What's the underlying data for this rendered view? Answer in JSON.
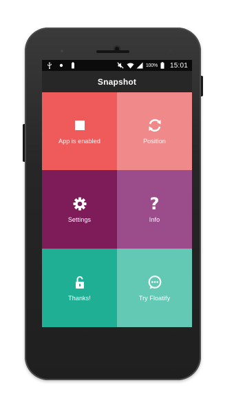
{
  "status_bar": {
    "battery_percent": "100%",
    "time": "15:01",
    "left_icons": [
      "usb-icon",
      "dot-icon",
      "battery-saver-icon"
    ],
    "right_icons": [
      "mute-icon",
      "wifi-icon",
      "signal-icon",
      "battery-icon"
    ]
  },
  "app_bar": {
    "title": "Snapshot"
  },
  "tiles": [
    {
      "label": "App is enabled",
      "icon": "stop-square-icon",
      "color": "#EF5B5B"
    },
    {
      "label": "Position",
      "icon": "rotate-icon",
      "color": "#F08A8A"
    },
    {
      "label": "Settings",
      "icon": "gear-icon",
      "color": "#7E1C5A"
    },
    {
      "label": "Info",
      "icon": "question-icon",
      "color": "#9B4C8A"
    },
    {
      "label": "Thanks!",
      "icon": "unlock-icon",
      "color": "#1FAF95"
    },
    {
      "label": "Try Floatify",
      "icon": "chat-bubble-icon",
      "color": "#64C9B4"
    }
  ]
}
